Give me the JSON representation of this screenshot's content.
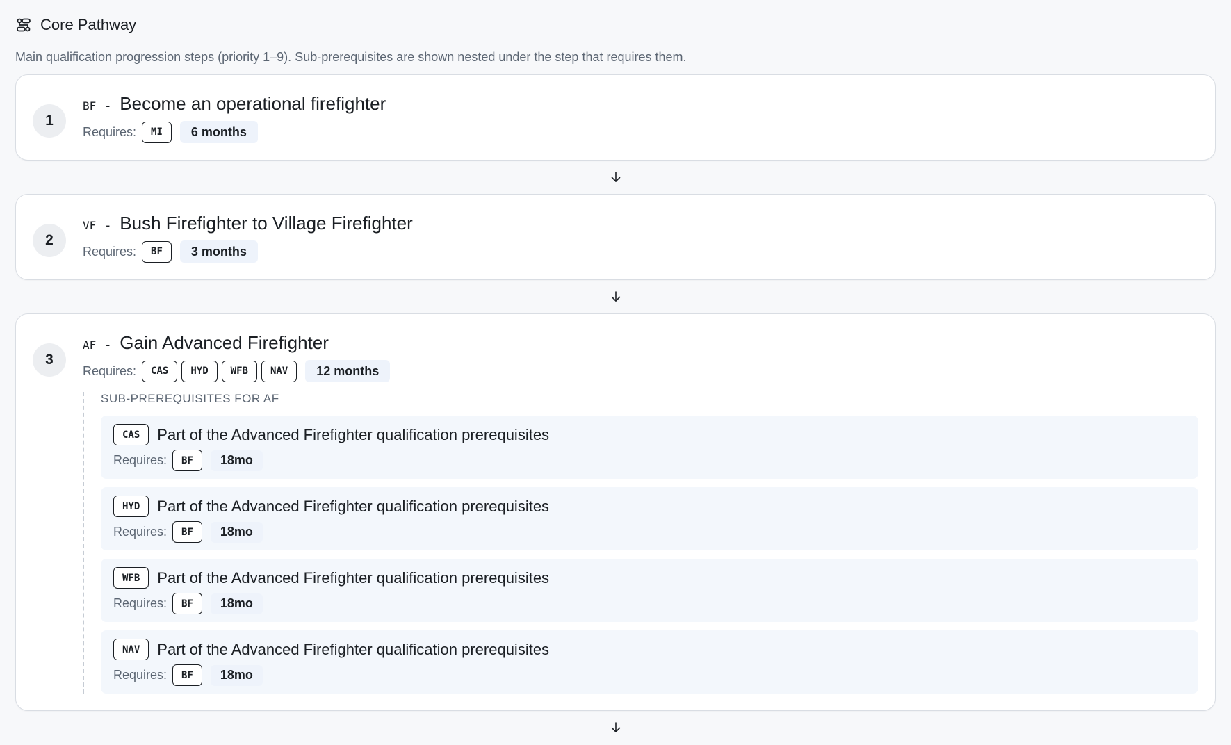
{
  "header": {
    "title": "Core Pathway",
    "description": "Main qualification progression steps (priority 1–9). Sub-prerequisites are shown nested under the step that requires them.",
    "icon": "pathway-icon"
  },
  "labels": {
    "requires": "Requires:",
    "dash": "-"
  },
  "steps": [
    {
      "number": "1",
      "code": "BF",
      "title": "Become an operational firefighter",
      "requires": [
        "MI"
      ],
      "duration": "6 months"
    },
    {
      "number": "2",
      "code": "VF",
      "title": "Bush Firefighter to Village Firefighter",
      "requires": [
        "BF"
      ],
      "duration": "3 months"
    },
    {
      "number": "3",
      "code": "AF",
      "title": "Gain Advanced Firefighter",
      "requires": [
        "CAS",
        "HYD",
        "WFB",
        "NAV"
      ],
      "duration": "12 months",
      "sub_heading": "SUB-PREREQUISITES FOR AF",
      "subs": [
        {
          "code": "CAS",
          "title": "Part of the Advanced Firefighter qualification prerequisites",
          "requires": [
            "BF"
          ],
          "duration": "18mo"
        },
        {
          "code": "HYD",
          "title": "Part of the Advanced Firefighter qualification prerequisites",
          "requires": [
            "BF"
          ],
          "duration": "18mo"
        },
        {
          "code": "WFB",
          "title": "Part of the Advanced Firefighter qualification prerequisites",
          "requires": [
            "BF"
          ],
          "duration": "18mo"
        },
        {
          "code": "NAV",
          "title": "Part of the Advanced Firefighter qualification prerequisites",
          "requires": [
            "BF"
          ],
          "duration": "18mo"
        }
      ]
    }
  ],
  "arrow_icon": "arrow-down-icon"
}
